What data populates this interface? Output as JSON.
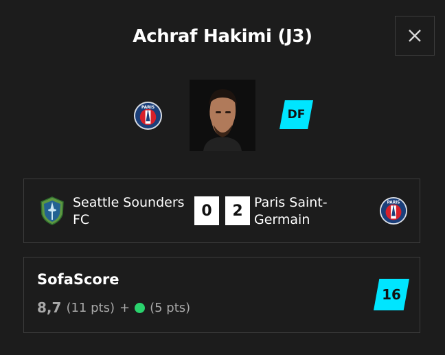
{
  "header": {
    "title": "Achraf Hakimi (J3)",
    "close_icon": "close-icon"
  },
  "player": {
    "club_badge_icon": "psg-crest-icon",
    "club_badge_text": "PARIS",
    "portrait_icon": "player-portrait",
    "position": "DF"
  },
  "match": {
    "home_team": {
      "name": "Seattle Sounders FC",
      "logo_icon": "seattle-sounders-crest-icon"
    },
    "away_team": {
      "name": "Paris Saint-Germain",
      "logo_icon": "psg-crest-icon",
      "logo_text": "PARIS"
    },
    "home_score": "0",
    "away_score": "2"
  },
  "sofascore": {
    "title": "SofaScore",
    "rating": "8,7",
    "rating_pts": "(11 pts)",
    "plus": "+",
    "bonus_pts": "(5 pts)",
    "total": "16"
  },
  "colors": {
    "background": "#1c1c1c",
    "border": "#3d3d3d",
    "accent": "#00e5ff",
    "bonus_dot": "#2ad26d",
    "muted_text": "#a9a9a9"
  }
}
